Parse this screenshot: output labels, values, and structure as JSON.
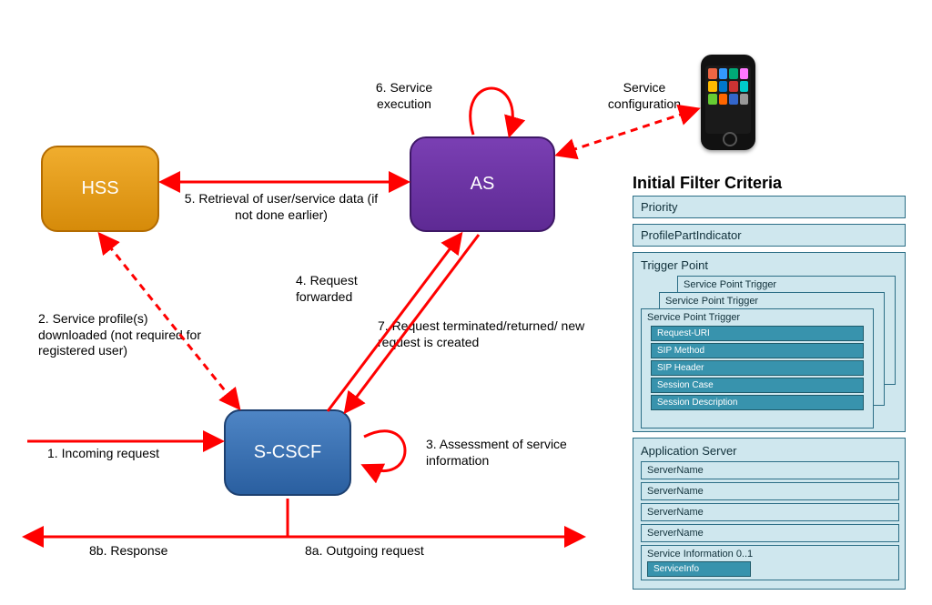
{
  "nodes": {
    "hss": "HSS",
    "as": "AS",
    "scscf": "S-CSCF"
  },
  "labels": {
    "step1": "1. Incoming request",
    "step2": "2. Service profile(s) downloaded (not required for registered user)",
    "step3": "3. Assessment of service information",
    "step4": "4. Request forwarded",
    "step5": "5. Retrieval of user/service data (if not done earlier)",
    "step6": "6. Service execution",
    "step7": "7. Request terminated/returned/ new request is created",
    "step8a": "8a. Outgoing request",
    "step8b": "8b. Response",
    "svc_config": "Service configuration"
  },
  "ifc": {
    "title": "Initial Filter Criteria",
    "priority": "Priority",
    "ppi": "ProfilePartIndicator",
    "trigger": {
      "title": "Trigger Point",
      "spt_label": "Service Point Trigger",
      "items": [
        "Request-URI",
        "SIP Method",
        "SIP Header",
        "Session Case",
        "Session Description"
      ]
    },
    "appserver": {
      "title": "Application Server",
      "servername": "ServerName",
      "svcinfo_label": "Service Information 0..1",
      "svcinfo_item": "ServiceInfo"
    }
  }
}
